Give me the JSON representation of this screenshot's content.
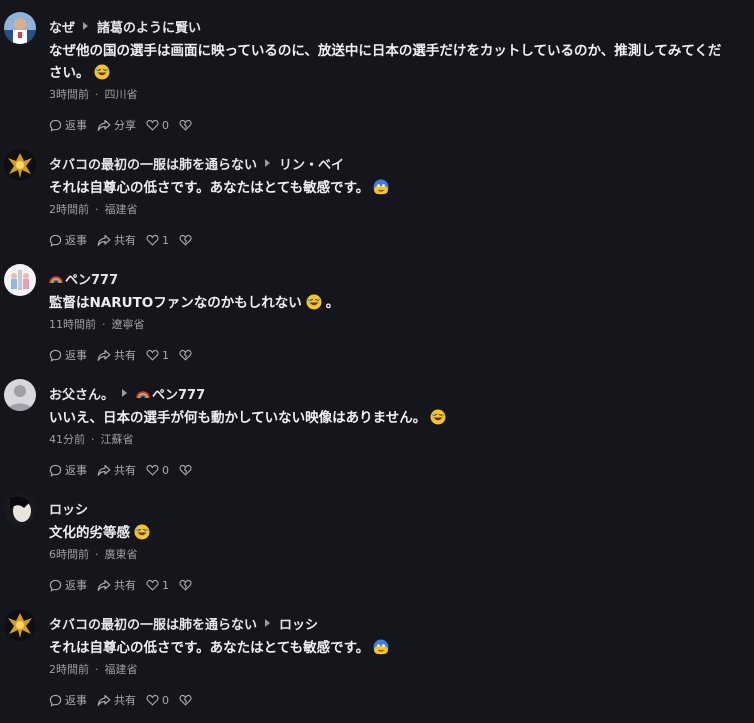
{
  "colors": {
    "background": "#15161c",
    "text": "#f0f0f2",
    "muted": "#9d9ea6",
    "action": "#a9aab2"
  },
  "actions": {
    "reply_label": "返事",
    "share_label": "分享",
    "share_alt_label": "共有"
  },
  "comments": [
    {
      "author": "なぜ",
      "reply_to": "諸葛のように賢い",
      "text": "なぜ他の国の選手は画面に映っているのに、放送中に日本の選手だけをカットしているのか、推測してみてください。",
      "emoji": "rofl-emoji",
      "time": "3時間前",
      "location": "四川省",
      "share": "分享",
      "likes": "0"
    },
    {
      "author": "タバコの最初の一服は肺を通らない",
      "reply_to": "リン・ベイ",
      "text": "それは自尊心の低さです。あなたはとても敏感です。",
      "emoji": "blue-face-emoji",
      "time": "2時間前",
      "location": "福建省",
      "share": "共有",
      "likes": "1"
    },
    {
      "author": "ペン777",
      "reply_to": "",
      "text": "監督はNARUTOファンなのかもしれない",
      "text_tail": "。",
      "emoji": "rofl-emoji",
      "time": "11時間前",
      "location": "遼寧省",
      "share": "共有",
      "likes": "1"
    },
    {
      "author": "お父さん。",
      "reply_to": "ペン777",
      "text": "いいえ、日本の選手が何も動かしていない映像はありません。",
      "emoji": "rofl-emoji",
      "time": "41分前",
      "location": "江蘇省",
      "share": "共有",
      "likes": "0"
    },
    {
      "author": "ロッシ",
      "reply_to": "",
      "text": "文化的劣等感",
      "emoji": "rofl-emoji",
      "time": "6時間前",
      "location": "廣東省",
      "share": "共有",
      "likes": "1"
    },
    {
      "author": "タバコの最初の一服は肺を通らない",
      "reply_to": "ロッシ",
      "text": "それは自尊心の低さです。あなたはとても敏感です。",
      "emoji": "blue-face-emoji",
      "time": "2時間前",
      "location": "福建省",
      "share": "共有",
      "likes": "0"
    }
  ]
}
